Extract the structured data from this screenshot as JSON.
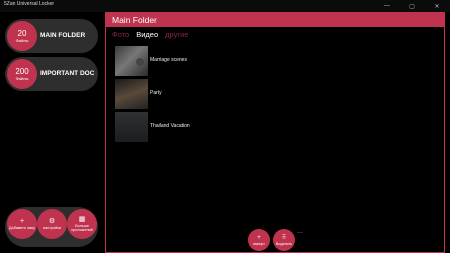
{
  "window": {
    "title": "5Zan Universal Locker",
    "controls": [
      "—",
      "▢",
      "✕"
    ]
  },
  "sidebar": {
    "folders": [
      {
        "count": "20",
        "unit": "Файлы",
        "name": "MAIN FOLDER"
      },
      {
        "count": "200",
        "unit": "Файлы",
        "name": "IMPORTANT DOC"
      }
    ],
    "actions": [
      {
        "icon": "+",
        "label": "Добавить папу",
        "icon_name": "plus-icon"
      },
      {
        "icon": "⚙",
        "label": "настройки",
        "icon_name": "gear-icon"
      },
      {
        "icon": "▦",
        "label": "Больше приложений",
        "icon_name": "apps-icon"
      }
    ]
  },
  "panel": {
    "title": "Main Folder",
    "tabs": [
      {
        "label": "Фото",
        "active": false
      },
      {
        "label": "Видео",
        "active": true
      },
      {
        "label": "другие",
        "active": false
      }
    ],
    "items": [
      {
        "label": "Marriage scenes"
      },
      {
        "label": "Party"
      },
      {
        "label": "Thailand Vacation"
      }
    ],
    "actions": [
      {
        "icon": "+",
        "label": "импорт"
      },
      {
        "icon": "⠿",
        "label": "Выделить"
      }
    ],
    "more": "···"
  },
  "colors": {
    "accent": "#c0334f",
    "sidebar_card": "#2e2e2e",
    "background": "#000000"
  }
}
